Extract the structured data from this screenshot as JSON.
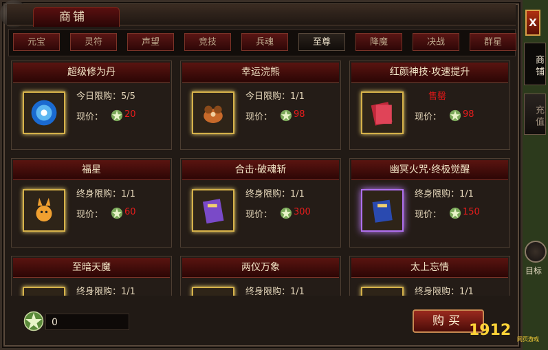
{
  "window": {
    "title": "商铺"
  },
  "tabs": [
    {
      "label": "元宝",
      "active": false
    },
    {
      "label": "灵符",
      "active": false
    },
    {
      "label": "声望",
      "active": false
    },
    {
      "label": "竞技",
      "active": false
    },
    {
      "label": "兵魂",
      "active": false
    },
    {
      "label": "至尊",
      "active": true
    },
    {
      "label": "降魔",
      "active": false
    },
    {
      "label": "决战",
      "active": false
    },
    {
      "label": "群星",
      "active": false
    }
  ],
  "items": [
    {
      "name": "超级修为丹",
      "limit": "今日限购：5/5",
      "price_label": "现价：",
      "price": "20",
      "icon": "blue-orb-icon"
    },
    {
      "name": "幸运浣熊",
      "limit": "今日限购：1/1",
      "price_label": "现价：",
      "price": "98",
      "icon": "raccoon-icon"
    },
    {
      "name": "红颜神技·攻速提升",
      "status": "售罄",
      "price_label": "现价：",
      "price": "98",
      "icon": "red-scroll-book-icon"
    },
    {
      "name": "福星",
      "limit": "终身限购：1/1",
      "price_label": "现价：",
      "price": "60",
      "icon": "fox-pet-icon"
    },
    {
      "name": "合击·破魂斩",
      "limit": "终身限购：1/1",
      "price_label": "现价：",
      "price": "300",
      "icon": "purple-book-icon"
    },
    {
      "name": "幽冥火咒·终极觉醒",
      "limit": "终身限购：1/1",
      "price_label": "现价：",
      "price": "150",
      "icon": "blue-book-icon"
    },
    {
      "name": "至暗天魔",
      "limit": "终身限购：1/1",
      "icon": "dark-demon-icon"
    },
    {
      "name": "两仪万象",
      "limit": "终身限购：1/1",
      "icon": "yin-yang-icon"
    },
    {
      "name": "太上忘情",
      "limit": "终身限购：1/1",
      "icon": "heart-icon"
    }
  ],
  "balance": "0",
  "buy_button": "购买",
  "close_button": "X",
  "side_tabs": [
    {
      "label": "商铺",
      "active": true
    },
    {
      "label": "充值",
      "active": false
    }
  ],
  "side_target": "目标",
  "watermark": "1912",
  "watermark_small": "网页游戏",
  "colors": {
    "price_red": "#e81c1c",
    "gold_border": "#d6b24a",
    "tab_red": "#5a1614"
  }
}
